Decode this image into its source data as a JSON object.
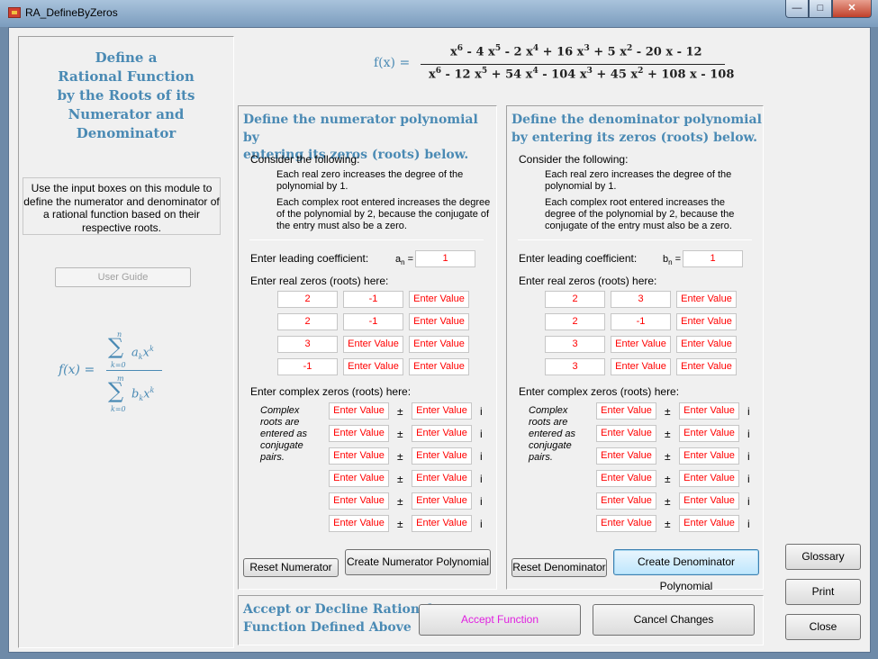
{
  "window": {
    "title": "RA_DefineByZeros"
  },
  "left": {
    "title": [
      "Define a",
      "Rational Function",
      "by the Roots of its",
      "Numerator and",
      "Denominator"
    ],
    "description": "Use the input boxes on this module to define the numerator and denominator of a rational function based on their respective roots.",
    "user_guide_label": "User Guide",
    "formula": {
      "fx": "f(x) =",
      "sigma": "∑",
      "upper_num": "n",
      "lower_num": "k=0",
      "num_term": "a",
      "num_sub": "k",
      "num_x": "x",
      "num_sup": "k",
      "upper_den": "m",
      "lower_den": "k=0",
      "den_term": "b",
      "den_sub": "k",
      "den_x": "x",
      "den_sup": "k"
    }
  },
  "function_display": {
    "label": "f(x) =",
    "numerator": [
      "x",
      "6",
      " -  4 x",
      "5",
      " -  2 x",
      "4",
      " +  16 x",
      "3",
      " +  5 x",
      "2",
      " -  20 x -  12"
    ],
    "denominator": [
      "x",
      "6",
      " -  12 x",
      "5",
      " +  54 x",
      "4",
      " -  104 x",
      "3",
      " +  45 x",
      "2",
      " +  108 x -  108"
    ]
  },
  "numerator": {
    "title": [
      "Define the numerator polynomial by",
      "entering its zeros (roots) below."
    ],
    "consider": "Consider the following:",
    "note1": "Each real zero increases the degree of the polynomial by 1.",
    "note2": "Each complex root entered increases the degree of the polynomial by 2, because the conjugate of the entry must also be a zero.",
    "leading_label": "Enter leading coefficient:",
    "coef_label": "a",
    "coef_sub": "n",
    "coef_eq": " =",
    "leading_value": "1",
    "real_label": "Enter real zeros (roots) here:",
    "real_zeros": [
      [
        "2",
        "-1",
        "Enter Value"
      ],
      [
        "2",
        "-1",
        "Enter Value"
      ],
      [
        "3",
        "Enter Value",
        "Enter Value"
      ],
      [
        "-1",
        "Enter Value",
        "Enter Value"
      ]
    ],
    "complex_label": "Enter complex zeros (roots) here:",
    "complex_note": [
      "Complex",
      "roots are",
      "entered as",
      "conjugate",
      "pairs."
    ],
    "complex_zeros": [
      [
        "Enter Value",
        "Enter Value"
      ],
      [
        "Enter Value",
        "Enter Value"
      ],
      [
        "Enter Value",
        "Enter Value"
      ],
      [
        "Enter Value",
        "Enter Value"
      ],
      [
        "Enter Value",
        "Enter Value"
      ],
      [
        "Enter Value",
        "Enter Value"
      ]
    ],
    "plus_minus": "±",
    "imag": "i",
    "reset_label": "Reset Numerator",
    "create_label": "Create Numerator Polynomial"
  },
  "denominator": {
    "title": [
      "Define the denominator polynomial",
      "by entering its zeros (roots) below."
    ],
    "consider": "Consider the following:",
    "note1": "Each real zero increases the degree of the polynomial by 1.",
    "note2": "Each complex root entered increases the degree of the polynomial by 2, because the conjugate of the entry must also be a zero.",
    "leading_label": "Enter leading coefficient:",
    "coef_label": "b",
    "coef_sub": "n",
    "coef_eq": " =",
    "leading_value": "1",
    "real_label": "Enter real zeros (roots) here:",
    "real_zeros": [
      [
        "2",
        "3",
        "Enter Value"
      ],
      [
        "2",
        "-1",
        "Enter Value"
      ],
      [
        "3",
        "Enter Value",
        "Enter Value"
      ],
      [
        "3",
        "Enter Value",
        "Enter Value"
      ]
    ],
    "complex_label": "Enter complex zeros (roots) here:",
    "complex_note": [
      "Complex",
      "roots are",
      "entered as",
      "conjugate",
      "pairs."
    ],
    "complex_zeros": [
      [
        "Enter Value",
        "Enter Value"
      ],
      [
        "Enter Value",
        "Enter Value"
      ],
      [
        "Enter Value",
        "Enter Value"
      ],
      [
        "Enter Value",
        "Enter Value"
      ],
      [
        "Enter Value",
        "Enter Value"
      ],
      [
        "Enter Value",
        "Enter Value"
      ]
    ],
    "plus_minus": "±",
    "imag": "i",
    "reset_label": "Reset Denominator",
    "create_label": "Create Denominator Polynomial"
  },
  "accept": {
    "title": [
      "Accept or Decline Rational",
      "Function Defined Above"
    ],
    "accept_label": "Accept Function",
    "cancel_label": "Cancel Changes"
  },
  "side_buttons": {
    "glossary": "Glossary",
    "print": "Print",
    "close": "Close"
  },
  "colors": {
    "title_blue": "#4a8ab4",
    "value_red": "#ff0000",
    "accept_magenta": "#e020e0"
  }
}
